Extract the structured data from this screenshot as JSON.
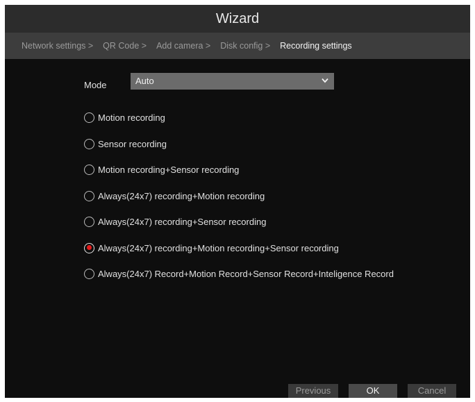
{
  "window": {
    "title": "Wizard"
  },
  "steps": [
    {
      "label": "Network settings >"
    },
    {
      "label": "QR Code >"
    },
    {
      "label": "Add camera >"
    },
    {
      "label": "Disk config >"
    },
    {
      "label": "Recording settings"
    }
  ],
  "active_step": "Recording settings",
  "mode": {
    "label": "Mode",
    "value": "Auto",
    "icon": "chevron-down-icon"
  },
  "recording_options": [
    {
      "label": "Motion recording",
      "selected": false
    },
    {
      "label": "Sensor recording",
      "selected": false
    },
    {
      "label": "Motion recording+Sensor recording",
      "selected": false
    },
    {
      "label": "Always(24x7) recording+Motion recording",
      "selected": false
    },
    {
      "label": "Always(24x7) recording+Sensor recording",
      "selected": false
    },
    {
      "label": "Always(24x7) recording+Motion recording+Sensor recording",
      "selected": true
    },
    {
      "label": "Always(24x7) Record+Motion Record+Sensor Record+Inteligence Record",
      "selected": false
    }
  ],
  "buttons": {
    "previous": "Previous",
    "ok": "OK",
    "cancel": "Cancel"
  },
  "colors": {
    "accent_selected": "#e51b1b",
    "background": "#0e0e0e",
    "title_bar": "#2c2c2c",
    "step_bar": "#3d3d3d"
  }
}
